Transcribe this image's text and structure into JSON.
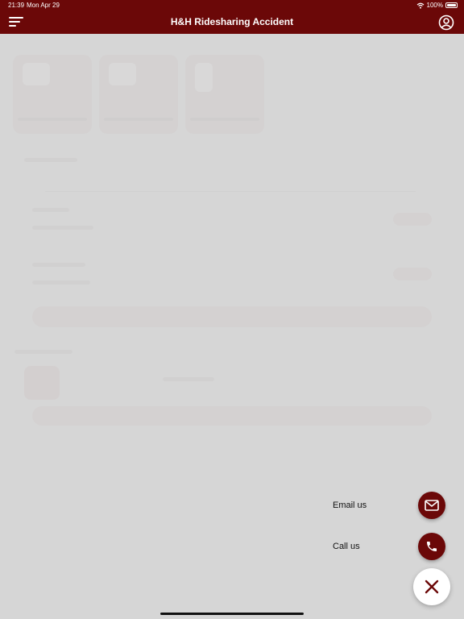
{
  "status_bar": {
    "time": "21:39",
    "date": "Mon Apr 29",
    "battery": "100%"
  },
  "header": {
    "title": "H&H Ridesharing Accident"
  },
  "fab_menu": {
    "items": [
      {
        "label": "Email us",
        "icon": "mail-icon"
      },
      {
        "label": "Call us",
        "icon": "phone-icon"
      }
    ],
    "close_icon": "close-icon"
  },
  "colors": {
    "brand": "#6b0808",
    "background": "#d6d6d6"
  }
}
